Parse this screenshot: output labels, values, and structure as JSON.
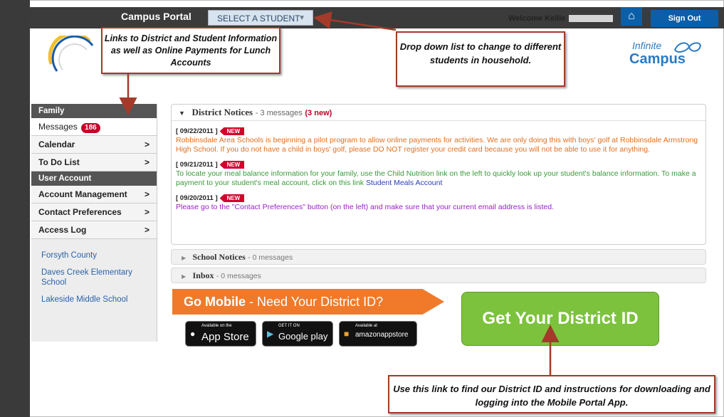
{
  "header": {
    "portal_title": "Campus Portal",
    "select_student": "SELECT A STUDENT",
    "welcome": "Welcome Kellie",
    "sign_out": "Sign Out"
  },
  "brand": {
    "infinite": "Infinite",
    "campus": "Campus"
  },
  "callouts": {
    "links": "Links to District and Student Information as well as Online Payments for Lunch Accounts",
    "dropdown": "Drop down list to change to different students in household.",
    "district_id": "Use this link to find our District ID and instructions for downloading and logging into the Mobile Portal App."
  },
  "sidebar": {
    "family_header": "Family",
    "messages": "Messages",
    "messages_count": "186",
    "calendar": "Calendar",
    "todo": "To Do List",
    "user_header": "User Account",
    "account_mgmt": "Account Management",
    "contact_prefs": "Contact Preferences",
    "access_log": "Access Log",
    "chevron": ">",
    "links": [
      "Forsyth County",
      "Daves Creek Elementary School",
      "Lakeside Middle School"
    ]
  },
  "district_notices": {
    "title": "District Notices",
    "count": "- 3 messages",
    "new_count": "(3 new)",
    "flag": "NEW",
    "items": [
      {
        "date": "[ 09/22/2011 ]",
        "text": "Robbinsdale Area Schools is beginning a pilot program to allow online payments for activities.  We are only doing this with boys' golf at Robbinsdale Armstrong High School.  If you do not have a child in boys' golf, please DO NOT register your credit card because you will not be able to use it for anything."
      },
      {
        "date": "[ 09/21/2011 ]",
        "text": "To locate your meal balance information for your family, use the Child Nutrition link on the left to quickly look up your student's balance information.  To make a payment to your student's meal account, click on this link",
        "link": "Student Meals Account"
      },
      {
        "date": "[ 09/20/2011 ]",
        "text": "Please go to the \"Contact Preferences\" button (on the left) and make sure that your current email address is listed."
      }
    ]
  },
  "school_notices": {
    "title": "School Notices",
    "count": "- 0 messages"
  },
  "inbox": {
    "title": "Inbox",
    "count": "- 0 messages"
  },
  "mobile": {
    "go_mobile": "Go Mobile",
    "need_id": "- Need Your District ID?",
    "appstore_small": "Available on the",
    "appstore_big": "App Store",
    "gplay_small": "GET IT ON",
    "gplay_big": "Google play",
    "amazon_small": "Available at",
    "amazon_big": "amazonappstore",
    "get_id": "Get Your District ID"
  },
  "colors": {
    "accent": "#0b5fa8",
    "arrow": "#a33a2a",
    "green": "#7cc23d",
    "orange": "#f07a2a"
  }
}
